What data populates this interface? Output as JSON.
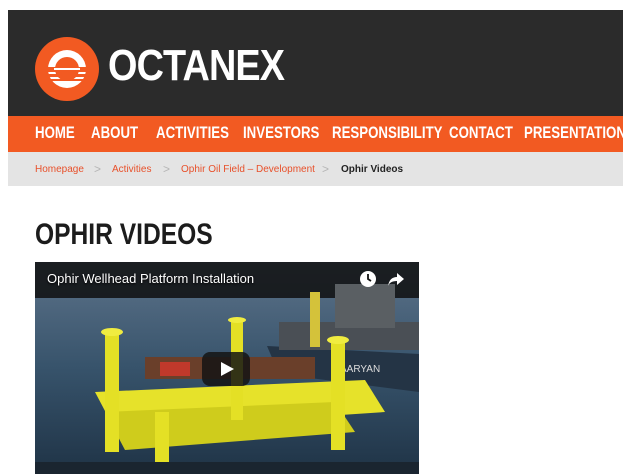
{
  "brand": {
    "name": "OCTANEX",
    "accent": "#f25a22",
    "header_bg": "#2b2b2b"
  },
  "nav": {
    "items": [
      {
        "label": "HOME"
      },
      {
        "label": "ABOUT"
      },
      {
        "label": "ACTIVITIES"
      },
      {
        "label": "INVESTORS"
      },
      {
        "label": "RESPONSIBILITY"
      },
      {
        "label": "CONTACT"
      },
      {
        "label": "PRESENTATIONS"
      }
    ]
  },
  "breadcrumb": {
    "items": [
      "Homepage",
      "Activities",
      "Ophir Oil Field – Development"
    ],
    "current": "Ophir Videos",
    "separator": ">"
  },
  "page": {
    "title": "OPHIR VIDEOS"
  },
  "video": {
    "title": "Ophir Wellhead Platform Installation",
    "icons": [
      "clock-icon",
      "share-icon",
      "play-icon"
    ]
  }
}
